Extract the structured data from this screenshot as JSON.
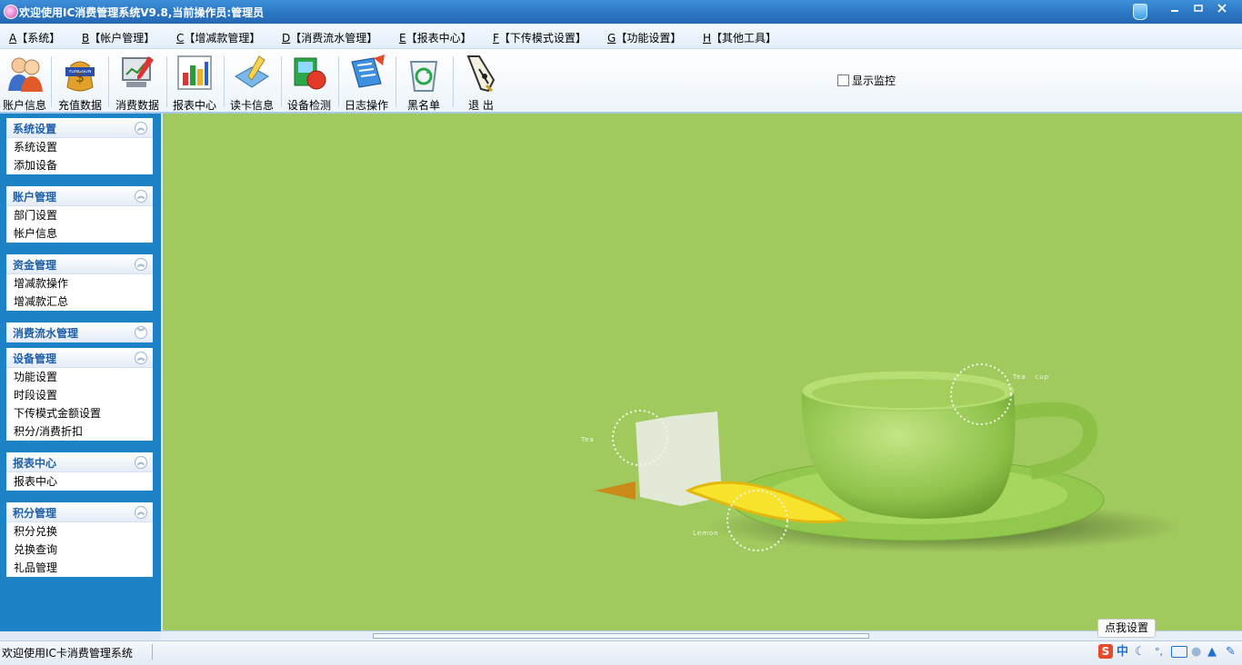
{
  "window": {
    "title": "欢迎使用IC消费管理系统V9.8,当前操作员:管理员"
  },
  "menu": [
    {
      "key": "A",
      "label": "【系统】"
    },
    {
      "key": "B",
      "label": "【帐户管理】"
    },
    {
      "key": "C",
      "label": "【增减款管理】"
    },
    {
      "key": "D",
      "label": "【消费流水管理】"
    },
    {
      "key": "E",
      "label": "【报表中心】"
    },
    {
      "key": "F",
      "label": "【下传模式设置】"
    },
    {
      "key": "G",
      "label": "【功能设置】"
    },
    {
      "key": "H",
      "label": "【其他工具】"
    }
  ],
  "toolbar": {
    "buttons": [
      {
        "label": "账户信息",
        "icon": "users-icon"
      },
      {
        "label": "充值数据",
        "icon": "money-bag-icon",
        "badge": "YONGSUN"
      },
      {
        "label": "消费数据",
        "icon": "monitor-pen-icon"
      },
      {
        "label": "报表中心",
        "icon": "bar-chart-icon"
      },
      {
        "label": "读卡信息",
        "icon": "card-reader-icon"
      },
      {
        "label": "设备检测",
        "icon": "device-check-icon"
      },
      {
        "label": "日志操作",
        "icon": "log-icon"
      },
      {
        "label": "黑名单",
        "icon": "recycle-bin-icon"
      },
      {
        "label": "退 出",
        "icon": "pen-nib-exit-icon"
      }
    ],
    "monitor_label": "显示监控",
    "monitor_checked": false
  },
  "sidebar": {
    "panels": [
      {
        "title": "系统设置",
        "expanded": true,
        "items": [
          "系统设置",
          "添加设备"
        ]
      },
      {
        "title": "账户管理",
        "expanded": true,
        "items": [
          "部门设置",
          "帐户信息"
        ]
      },
      {
        "title": "资金管理",
        "expanded": true,
        "items": [
          "增减款操作",
          "增减款汇总"
        ]
      },
      {
        "title": "消费流水管理",
        "expanded": false,
        "items": []
      },
      {
        "title": "设备管理",
        "expanded": true,
        "items": [
          "功能设置",
          "时段设置",
          "下传模式金额设置",
          "积分/消费折扣"
        ]
      },
      {
        "title": "报表中心",
        "expanded": true,
        "items": [
          "报表中心"
        ]
      },
      {
        "title": "积分管理",
        "expanded": true,
        "items": [
          "积分兑换",
          "兑换查询",
          "礼品管理"
        ]
      }
    ]
  },
  "wallpaper": {
    "background": "#a0c95e",
    "labels": {
      "tea": "Tea",
      "tea_cup": "Tea   cup",
      "tea_bag": "Tea",
      "lemon": "Lemon"
    }
  },
  "statusbar": {
    "text": "欢迎使用IC卡消费管理系统",
    "ime_tip": "点我设置",
    "ime_mode": "中"
  },
  "colors": {
    "title_bar": "#2a74c2",
    "sidebar": "#1e83c6",
    "panel_title": "#1f5fa8",
    "main_bg": "#a0c95e"
  }
}
